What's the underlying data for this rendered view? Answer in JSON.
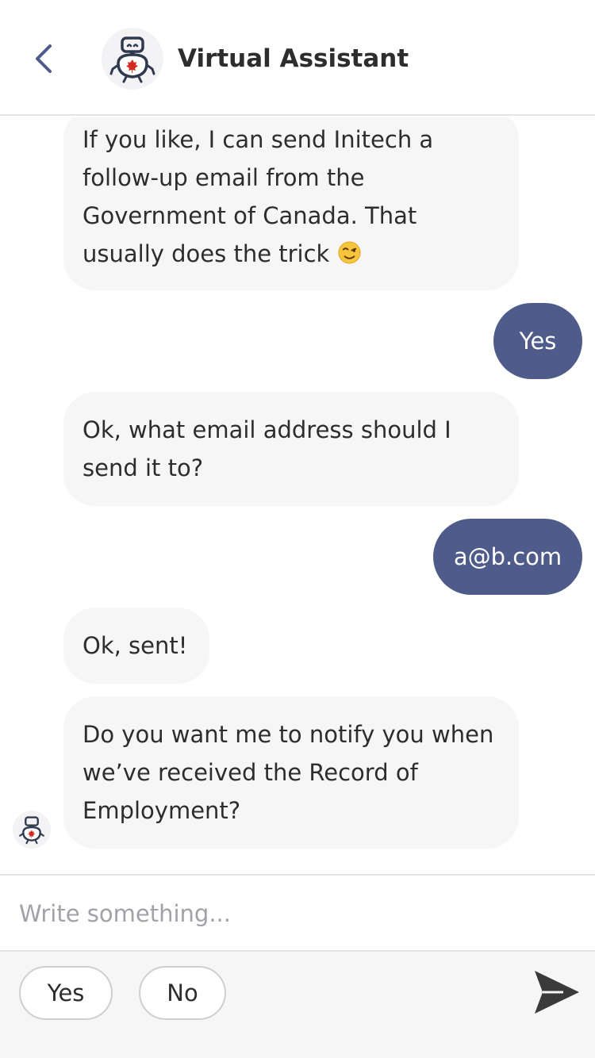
{
  "header": {
    "title": "Virtual Assistant",
    "back_icon": "chevron-left-icon",
    "avatar_icon": "robot-maple-leaf-icon"
  },
  "messages": [
    {
      "from": "bot",
      "text": "If you like, I can send Initech a follow-up email from the Government of Canada. That usually does the trick",
      "emoji": "winking-face-emoji"
    },
    {
      "from": "user",
      "text": "Yes"
    },
    {
      "from": "bot",
      "text": "Ok, what email address should I send it to?"
    },
    {
      "from": "user",
      "text": "a@b.com"
    },
    {
      "from": "bot",
      "text": "Ok, sent!"
    },
    {
      "from": "bot",
      "text": "Do you want me to notify you when we’ve received the Record of Employment?"
    }
  ],
  "composer": {
    "placeholder": "Write something...",
    "value": ""
  },
  "quick_replies": [
    {
      "label": "Yes"
    },
    {
      "label": "No"
    }
  ],
  "send_icon": "send-arrow-icon",
  "colors": {
    "user_bubble": "#4f5b8a",
    "bot_bubble": "#f6f6f6",
    "accent": "#4f5b8a",
    "maple_red": "#d52b1e"
  }
}
